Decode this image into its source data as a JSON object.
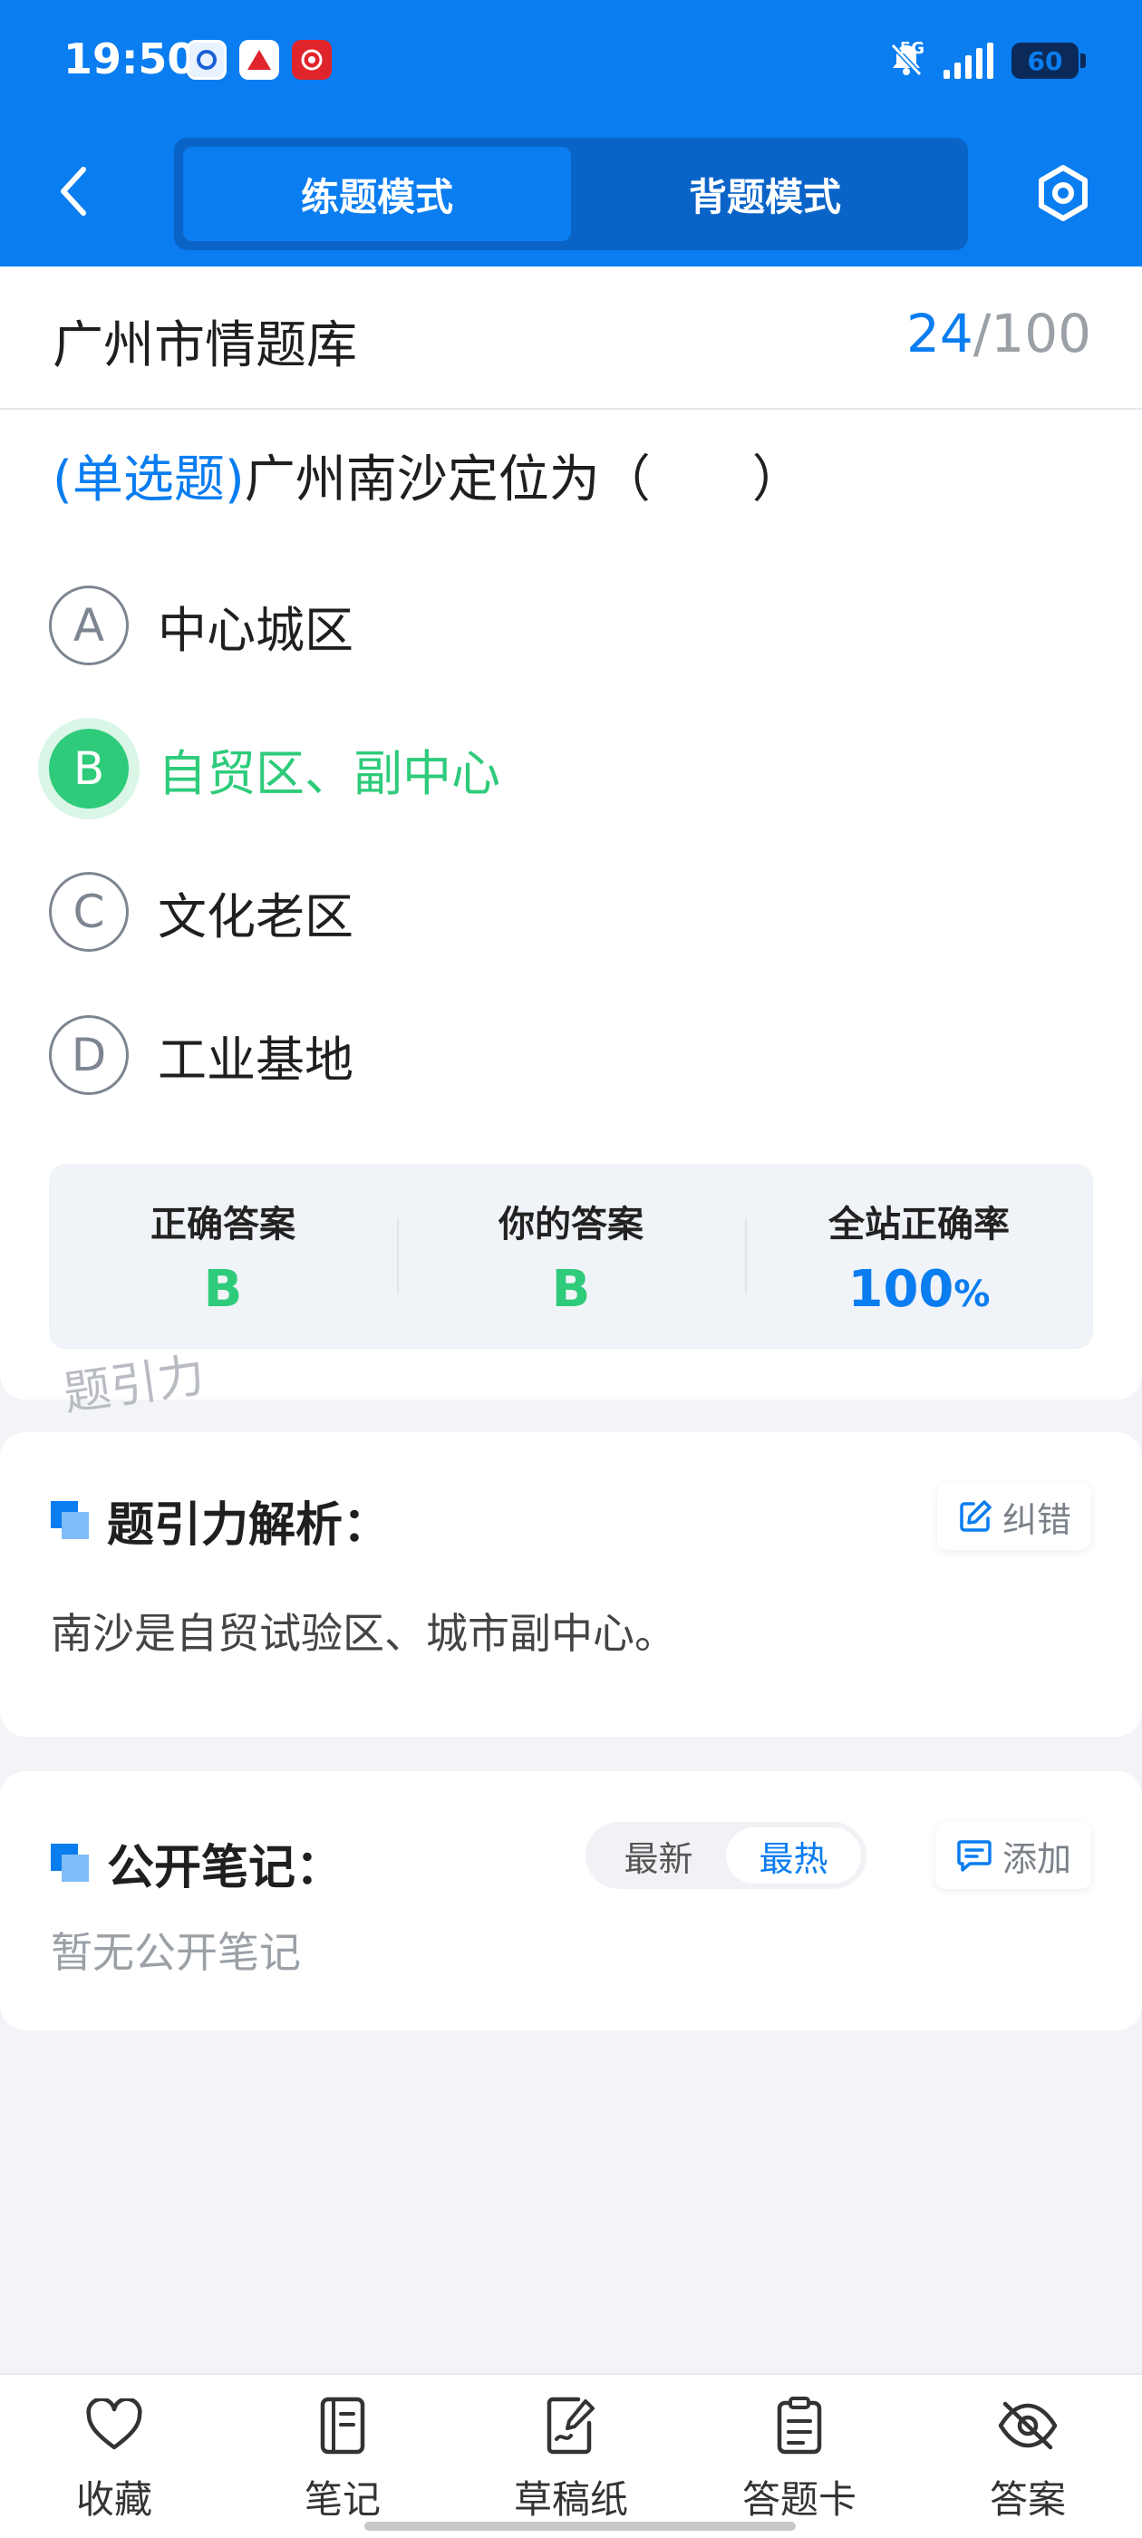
{
  "status_bar": {
    "time": "19:50",
    "network": "5G",
    "battery": "60"
  },
  "header": {
    "tabs": [
      {
        "label": "练题模式",
        "active": true
      },
      {
        "label": "背题模式",
        "active": false
      }
    ]
  },
  "question": {
    "bank_title": "广州市情题库",
    "progress_current": "24",
    "progress_total": "/100",
    "type_label": "(单选题)",
    "text": "广州南沙定位为（　　）",
    "options": [
      {
        "letter": "A",
        "text": "中心城区",
        "selected": false
      },
      {
        "letter": "B",
        "text": "自贸区、副中心",
        "selected": true
      },
      {
        "letter": "C",
        "text": "文化老区",
        "selected": false
      },
      {
        "letter": "D",
        "text": "工业基地",
        "selected": false
      }
    ],
    "answer_stats": {
      "correct_label": "正确答案",
      "correct_value": "B",
      "yours_label": "你的答案",
      "yours_value": "B",
      "rate_label": "全站正确率",
      "rate_value": "100",
      "rate_unit": "%"
    },
    "watermark": "题引力"
  },
  "analysis": {
    "title": "题引力解析：",
    "correct_button": "纠错",
    "text": "南沙是自贸试验区、城市副中心。"
  },
  "notes": {
    "title": "公开笔记：",
    "sort_options": [
      {
        "label": "最新",
        "active": false
      },
      {
        "label": "最热",
        "active": true
      }
    ],
    "add_button": "添加",
    "empty_text": "暂无公开笔记"
  },
  "bottom_nav": [
    {
      "label": "收藏",
      "icon": "heart-icon"
    },
    {
      "label": "笔记",
      "icon": "notebook-icon"
    },
    {
      "label": "草稿纸",
      "icon": "draft-paper-icon"
    },
    {
      "label": "答题卡",
      "icon": "answer-card-icon"
    },
    {
      "label": "答案",
      "icon": "eye-off-icon"
    }
  ],
  "colors": {
    "brand_blue": "#0a7df0",
    "correct_green": "#2ecb7a"
  }
}
